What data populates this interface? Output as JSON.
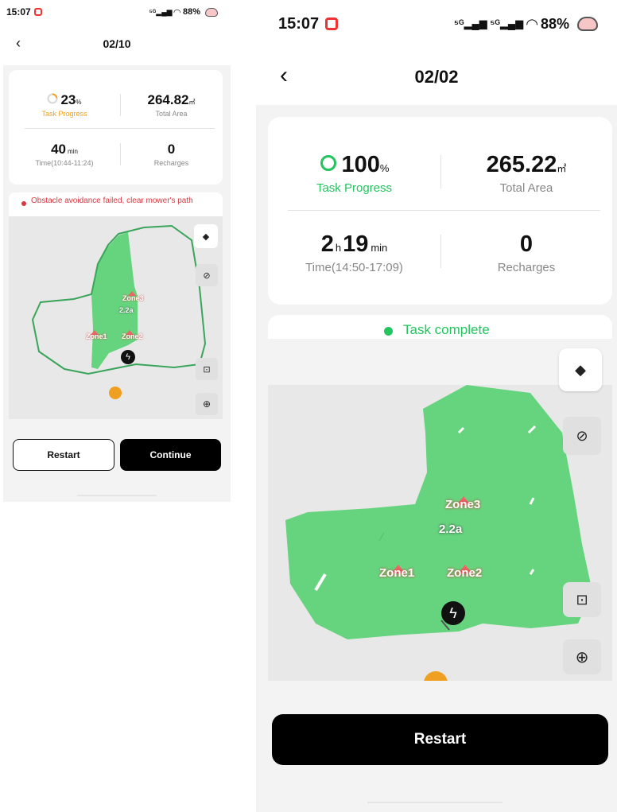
{
  "left": {
    "status": {
      "time": "15:07",
      "battery": "88%"
    },
    "header": {
      "title": "02/10"
    },
    "stats": {
      "progress_value": "23",
      "progress_unit": "%",
      "progress_label": "Task Progress",
      "progress_fraction": 0.23,
      "area_value": "264.82",
      "area_unit": "㎡",
      "area_label": "Total Area",
      "time_value": "40",
      "time_unit": "min",
      "time_label": "Time(10:44-11:24)",
      "recharges_value": "0",
      "recharges_label": "Recharges"
    },
    "alert": {
      "text": "Obstacle avoidance failed, clear mower's path"
    },
    "map": {
      "zones": [
        "Zone1",
        "Zone2",
        "Zone3"
      ],
      "area_tag": "2.2a"
    },
    "buttons": {
      "restart": "Restart",
      "continue": "Continue"
    }
  },
  "right": {
    "status": {
      "time": "15:07",
      "battery": "88%"
    },
    "header": {
      "title": "02/02"
    },
    "stats": {
      "progress_value": "100",
      "progress_unit": "%",
      "progress_label": "Task Progress",
      "progress_fraction": 1.0,
      "area_value": "265.22",
      "area_unit": "㎡",
      "area_label": "Total Area",
      "time_hours": "2",
      "time_hours_unit": "h",
      "time_value": "19",
      "time_unit": "min",
      "time_label": "Time(14:50-17:09)",
      "recharges_value": "0",
      "recharges_label": "Recharges"
    },
    "status_msg": {
      "text": "Task complete"
    },
    "map": {
      "zones": [
        "Zone1",
        "Zone2",
        "Zone3"
      ],
      "area_tag": "2.2a"
    },
    "buttons": {
      "restart": "Restart"
    }
  },
  "colors": {
    "accent_orange": "#f0a020",
    "success_green": "#22c55e",
    "mowed_green": "#66d47e",
    "boundary_green": "#3aa55a",
    "alert_red": "#d9363e",
    "button_black": "#000000"
  }
}
